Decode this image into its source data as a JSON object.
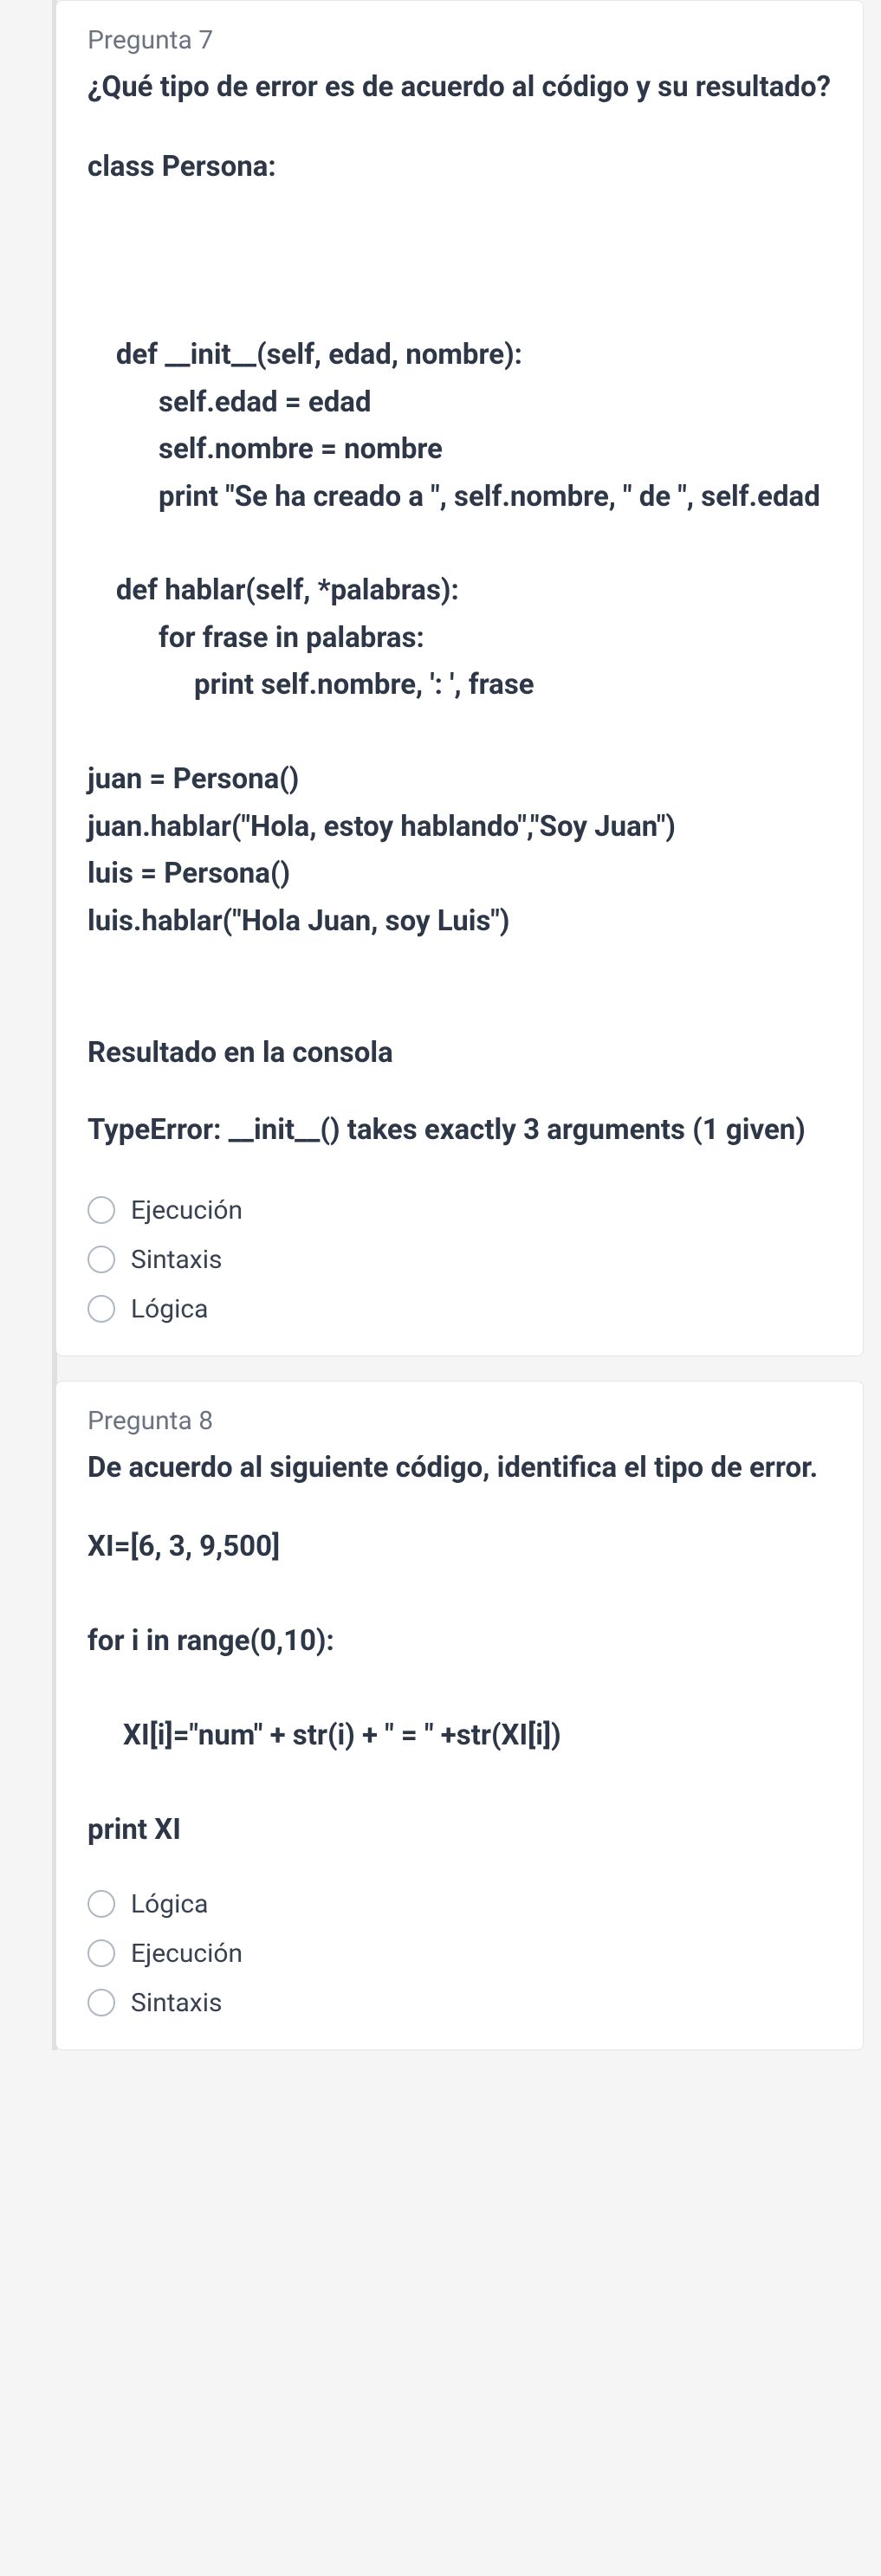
{
  "questions": [
    {
      "number": "Pregunta 7",
      "prompt": "¿Qué tipo de error es de acuerdo al código y su resultado?",
      "code": "class Persona:\n\n\n\n    def __init__(self, edad, nombre):\n          self.edad = edad\n          self.nombre = nombre\n          print \"Se ha creado a \", self.nombre, \" de \", self.edad\n\n    def hablar(self, *palabras):\n          for frase in palabras:\n               print self.nombre, ': ', frase\n\njuan = Persona()\njuan.hablar(\"Hola, estoy hablando\",\"Soy Juan\")\nluis = Persona()\nluis.hablar(\"Hola Juan, soy Luis\")",
      "result_label": "Resultado en la consola",
      "result_text": "TypeError: __init__() takes exactly 3 arguments (1 given)",
      "options": [
        "Ejecución",
        "Sintaxis",
        "Lógica"
      ]
    },
    {
      "number": "Pregunta 8",
      "prompt": "De acuerdo al siguiente código, identifica el tipo de error.",
      "code": "XI=[6, 3, 9,500]\n\nfor i in range(0,10):\n\n     XI[i]=\"num\" + str(i) + \" = \" +str(XI[i])\n\nprint XI",
      "result_label": "",
      "result_text": "",
      "options": [
        "Lógica",
        "Ejecución",
        "Sintaxis"
      ]
    }
  ]
}
